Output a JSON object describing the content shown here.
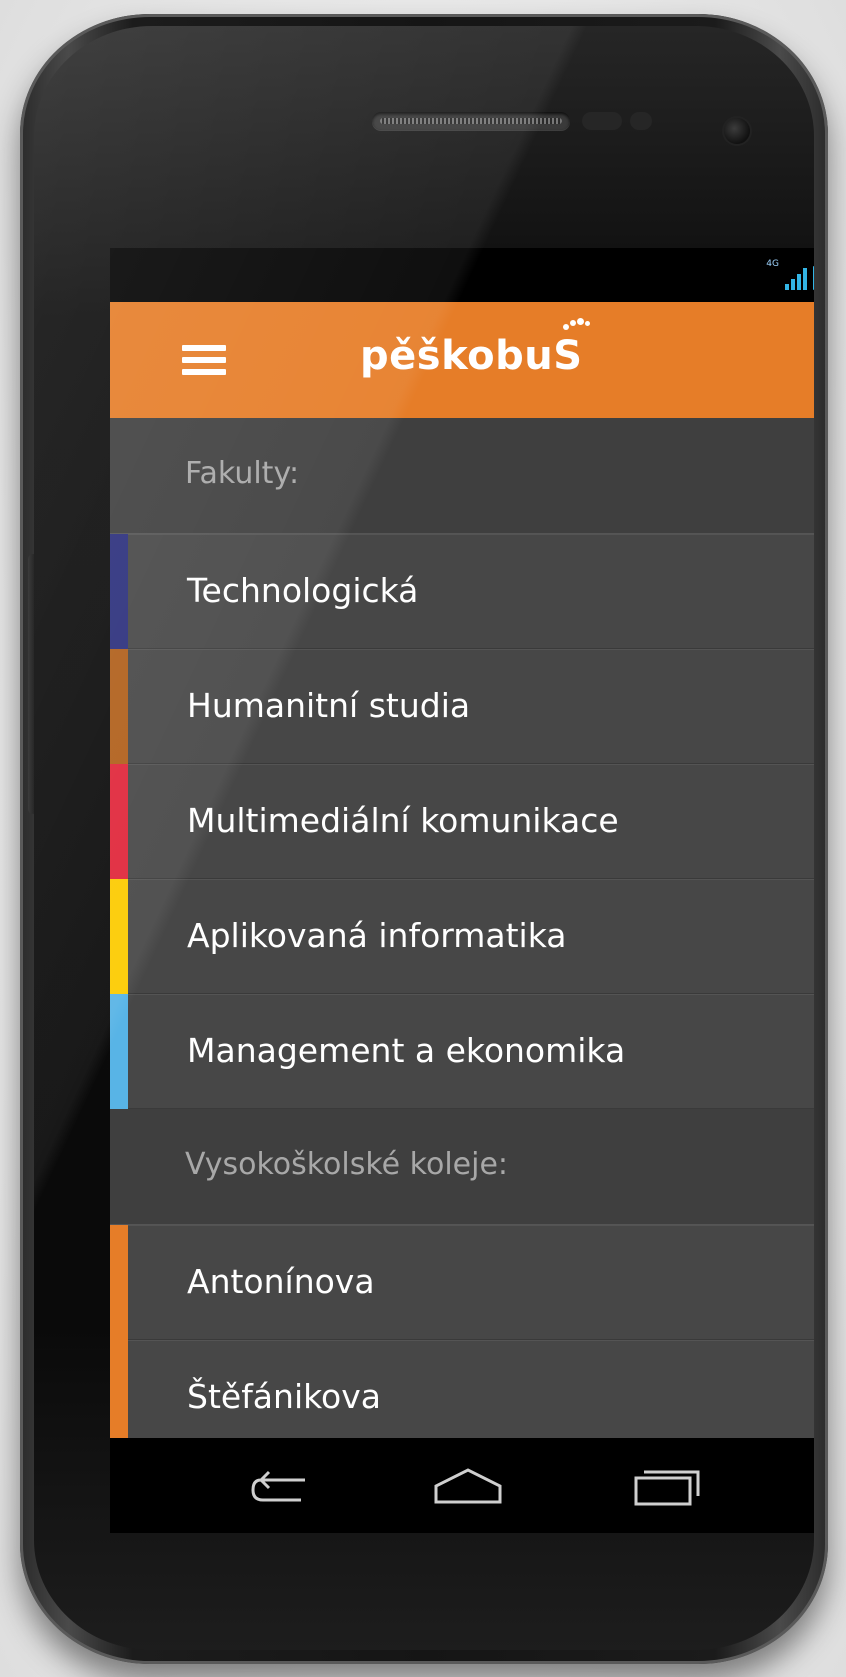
{
  "status_bar": {
    "network_type": "4G",
    "accent_color": "#33b5e5"
  },
  "action_bar": {
    "menu_icon": "hamburger-icon",
    "brand_text": "pěškobu",
    "brand_logo_glyph": "S",
    "background_color": "#e67d28"
  },
  "menu": {
    "sections": [
      {
        "header": "Fakulty:",
        "items": [
          {
            "label": "Technologická",
            "color": "#2b2f7c"
          },
          {
            "label": "Humanitní studia",
            "color": "#b05f1a"
          },
          {
            "label": "Multimediální komunikace",
            "color": "#e0263a"
          },
          {
            "label": "Aplikovaná informatika",
            "color": "#fccb00"
          },
          {
            "label": "Management a ekonomika",
            "color": "#58b4e6"
          }
        ]
      },
      {
        "header": "Vysokoškolské koleje:",
        "items": [
          {
            "label": "Antonínova",
            "color": "#e67d28"
          },
          {
            "label": "Štěfánikova",
            "color": "#e67d28"
          }
        ]
      }
    ]
  },
  "nav_bar": {
    "buttons": [
      "back-icon",
      "home-icon",
      "recent-apps-icon"
    ]
  }
}
